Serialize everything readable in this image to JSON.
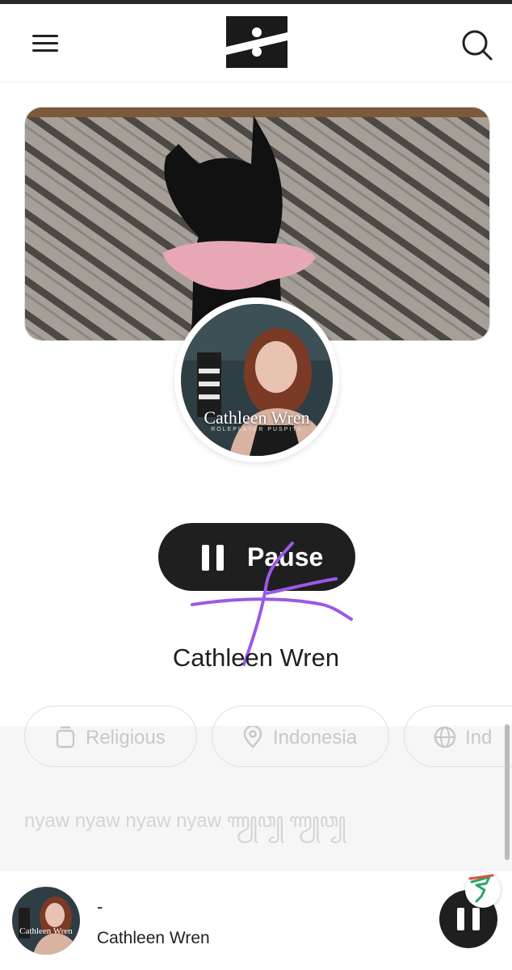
{
  "header": {
    "menu_icon": "hamburger-menu-icon",
    "logo_icon": "brand-logo-icon",
    "search_icon": "search-icon"
  },
  "profile": {
    "banner_image": "black cat wearing pink collar on patterned rug",
    "avatar_caption": "Cathleen Wren",
    "avatar_subcaption": "ROLEPLAYER PUSPITA",
    "name": "Cathleen Wren"
  },
  "play_button": {
    "label": "Pause",
    "icon": "pause-icon"
  },
  "chips": [
    {
      "label": "Religious",
      "icon": "jar-icon"
    },
    {
      "label": "Indonesia",
      "icon": "location-pin-icon"
    },
    {
      "label": "Ind",
      "icon": "globe-icon"
    }
  ],
  "about": {
    "text": "nyaw nyaw nyaw nyaw ꦟꦾꦮ꧀ ꦟꦾꦮ꧀"
  },
  "player": {
    "art_caption": "Cathleen Wren",
    "track_title": "-",
    "artist": "Cathleen Wren",
    "pause_icon": "pause-icon",
    "badge_icon": "flowchart-badge-icon"
  },
  "colors": {
    "button_dark": "#1f1f1f",
    "scribble": "#9b59e6",
    "chip_border": "#e0e0e0"
  }
}
